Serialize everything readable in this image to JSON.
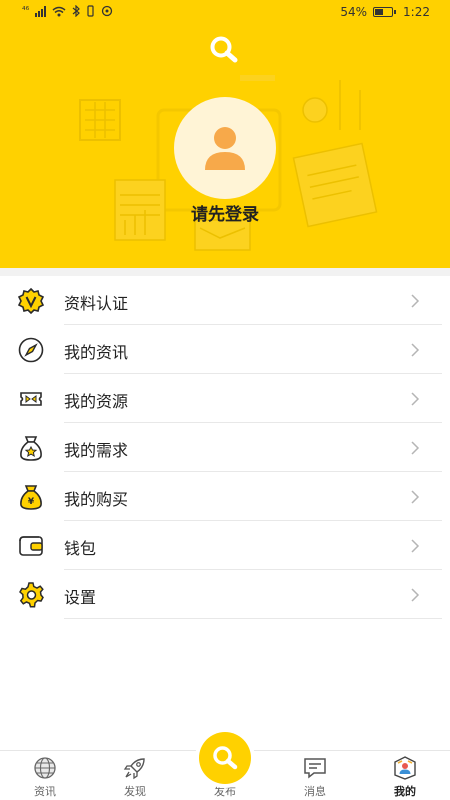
{
  "status_bar": {
    "network": "⁴⁶",
    "battery_percent": "54%",
    "battery_level": 0.54,
    "time": "1:22"
  },
  "profile": {
    "login_prompt": "请先登录"
  },
  "menu": [
    {
      "label": "资料认证",
      "icon": "verified-badge-icon"
    },
    {
      "label": "我的资讯",
      "icon": "compass-icon"
    },
    {
      "label": "我的资源",
      "icon": "ticket-icon"
    },
    {
      "label": "我的需求",
      "icon": "star-bag-icon"
    },
    {
      "label": "我的购买",
      "icon": "money-bag-icon"
    },
    {
      "label": "钱包",
      "icon": "wallet-icon"
    },
    {
      "label": "设置",
      "icon": "gear-icon"
    }
  ],
  "tabs": [
    {
      "label": "资讯",
      "icon": "globe-icon",
      "active": false
    },
    {
      "label": "发现",
      "icon": "rocket-icon",
      "active": false
    },
    {
      "label": "发布",
      "icon": "search-icon",
      "active": false
    },
    {
      "label": "消息",
      "icon": "message-icon",
      "active": false
    },
    {
      "label": "我的",
      "icon": "profile-icon",
      "active": true
    }
  ],
  "colors": {
    "brand_yellow": "#FFD100",
    "avatar_bg": "#FFF4D6",
    "avatar_figure": "#F7A94A",
    "icon_dark": "#2B2B2B"
  }
}
